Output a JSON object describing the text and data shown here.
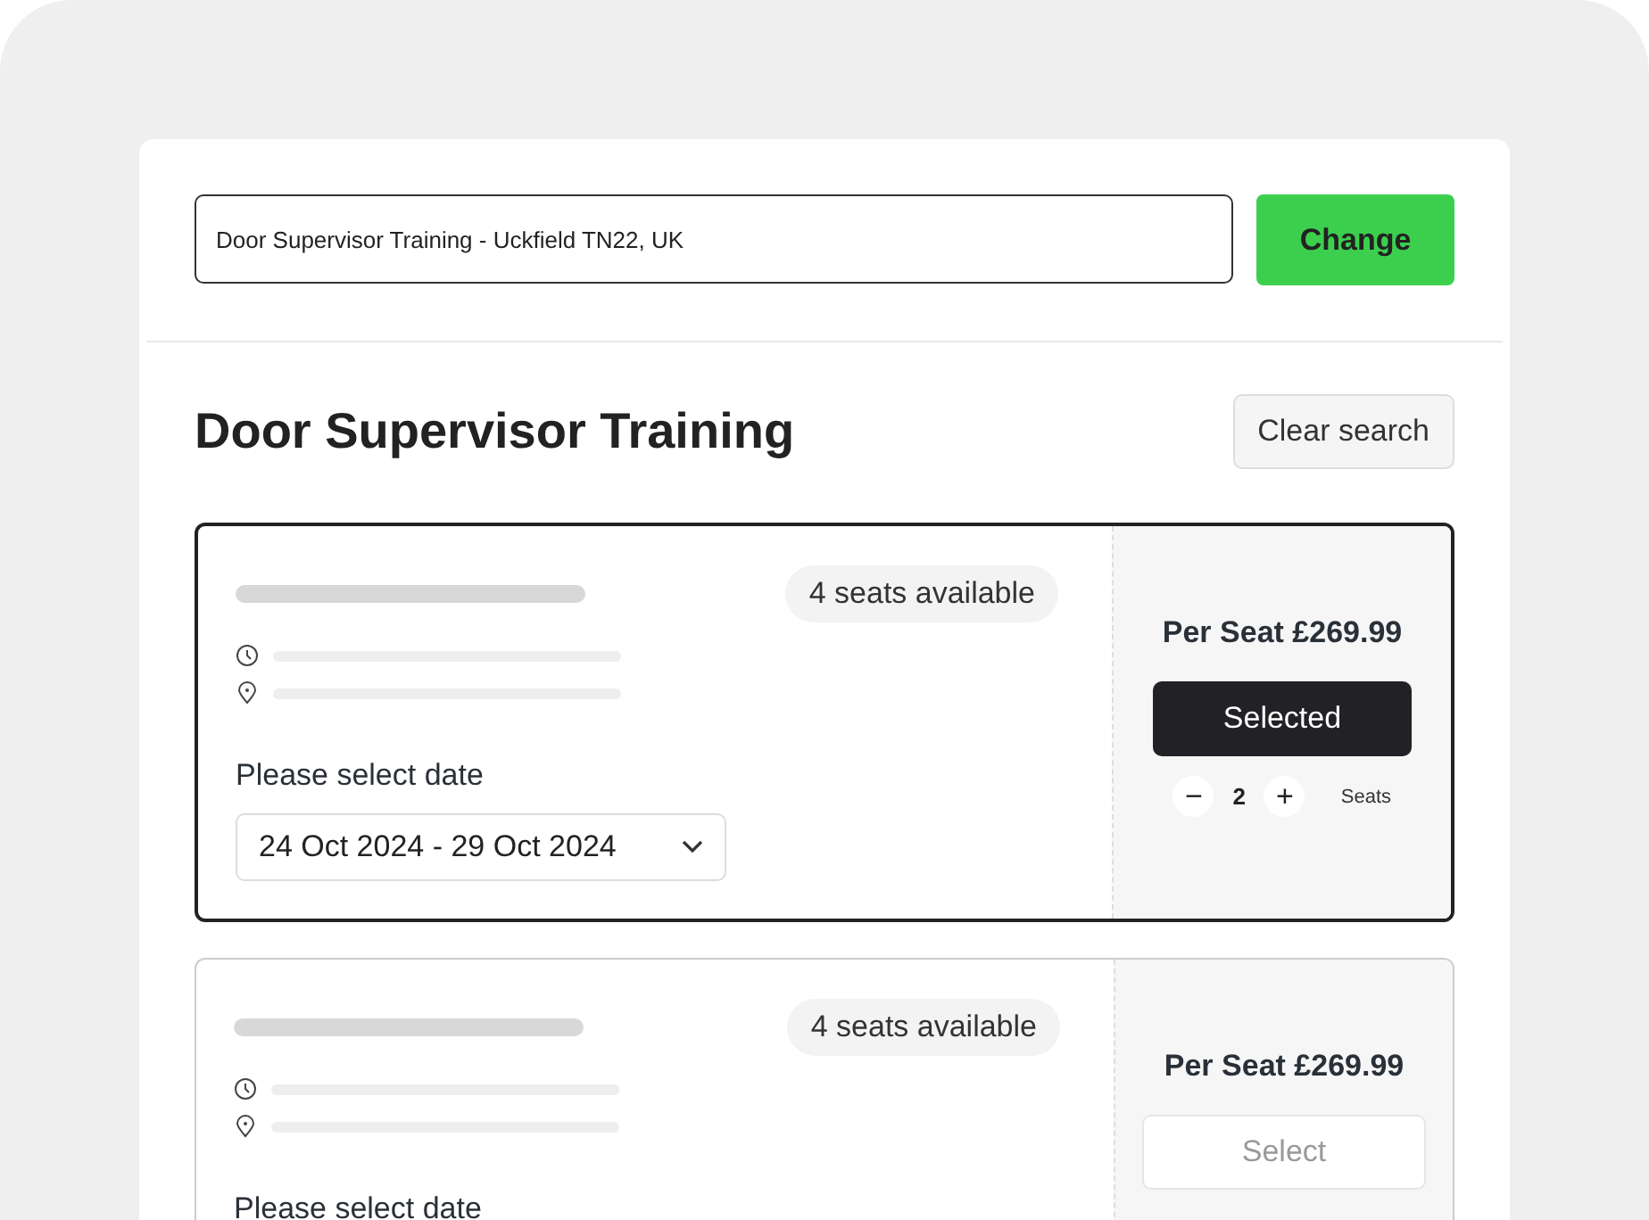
{
  "search": {
    "value": "Door Supervisor Training - Uckfield TN22, UK",
    "button": "Change"
  },
  "title": "Door Supervisor Training",
  "clear_button": "Clear search",
  "cards": [
    {
      "availability": "4 seats available",
      "date_label": "Please select date",
      "date": "24 Oct 2024 - 29 Oct 2024",
      "price": "Per Seat £269.99",
      "button": "Selected",
      "selected": true,
      "stepper": {
        "minus": "−",
        "count": "2",
        "plus": "+",
        "unit": "Seats"
      }
    },
    {
      "availability": "4 seats available",
      "date_label": "Please select date",
      "price": "Per Seat £269.99",
      "button": "Select",
      "selected": false
    }
  ]
}
